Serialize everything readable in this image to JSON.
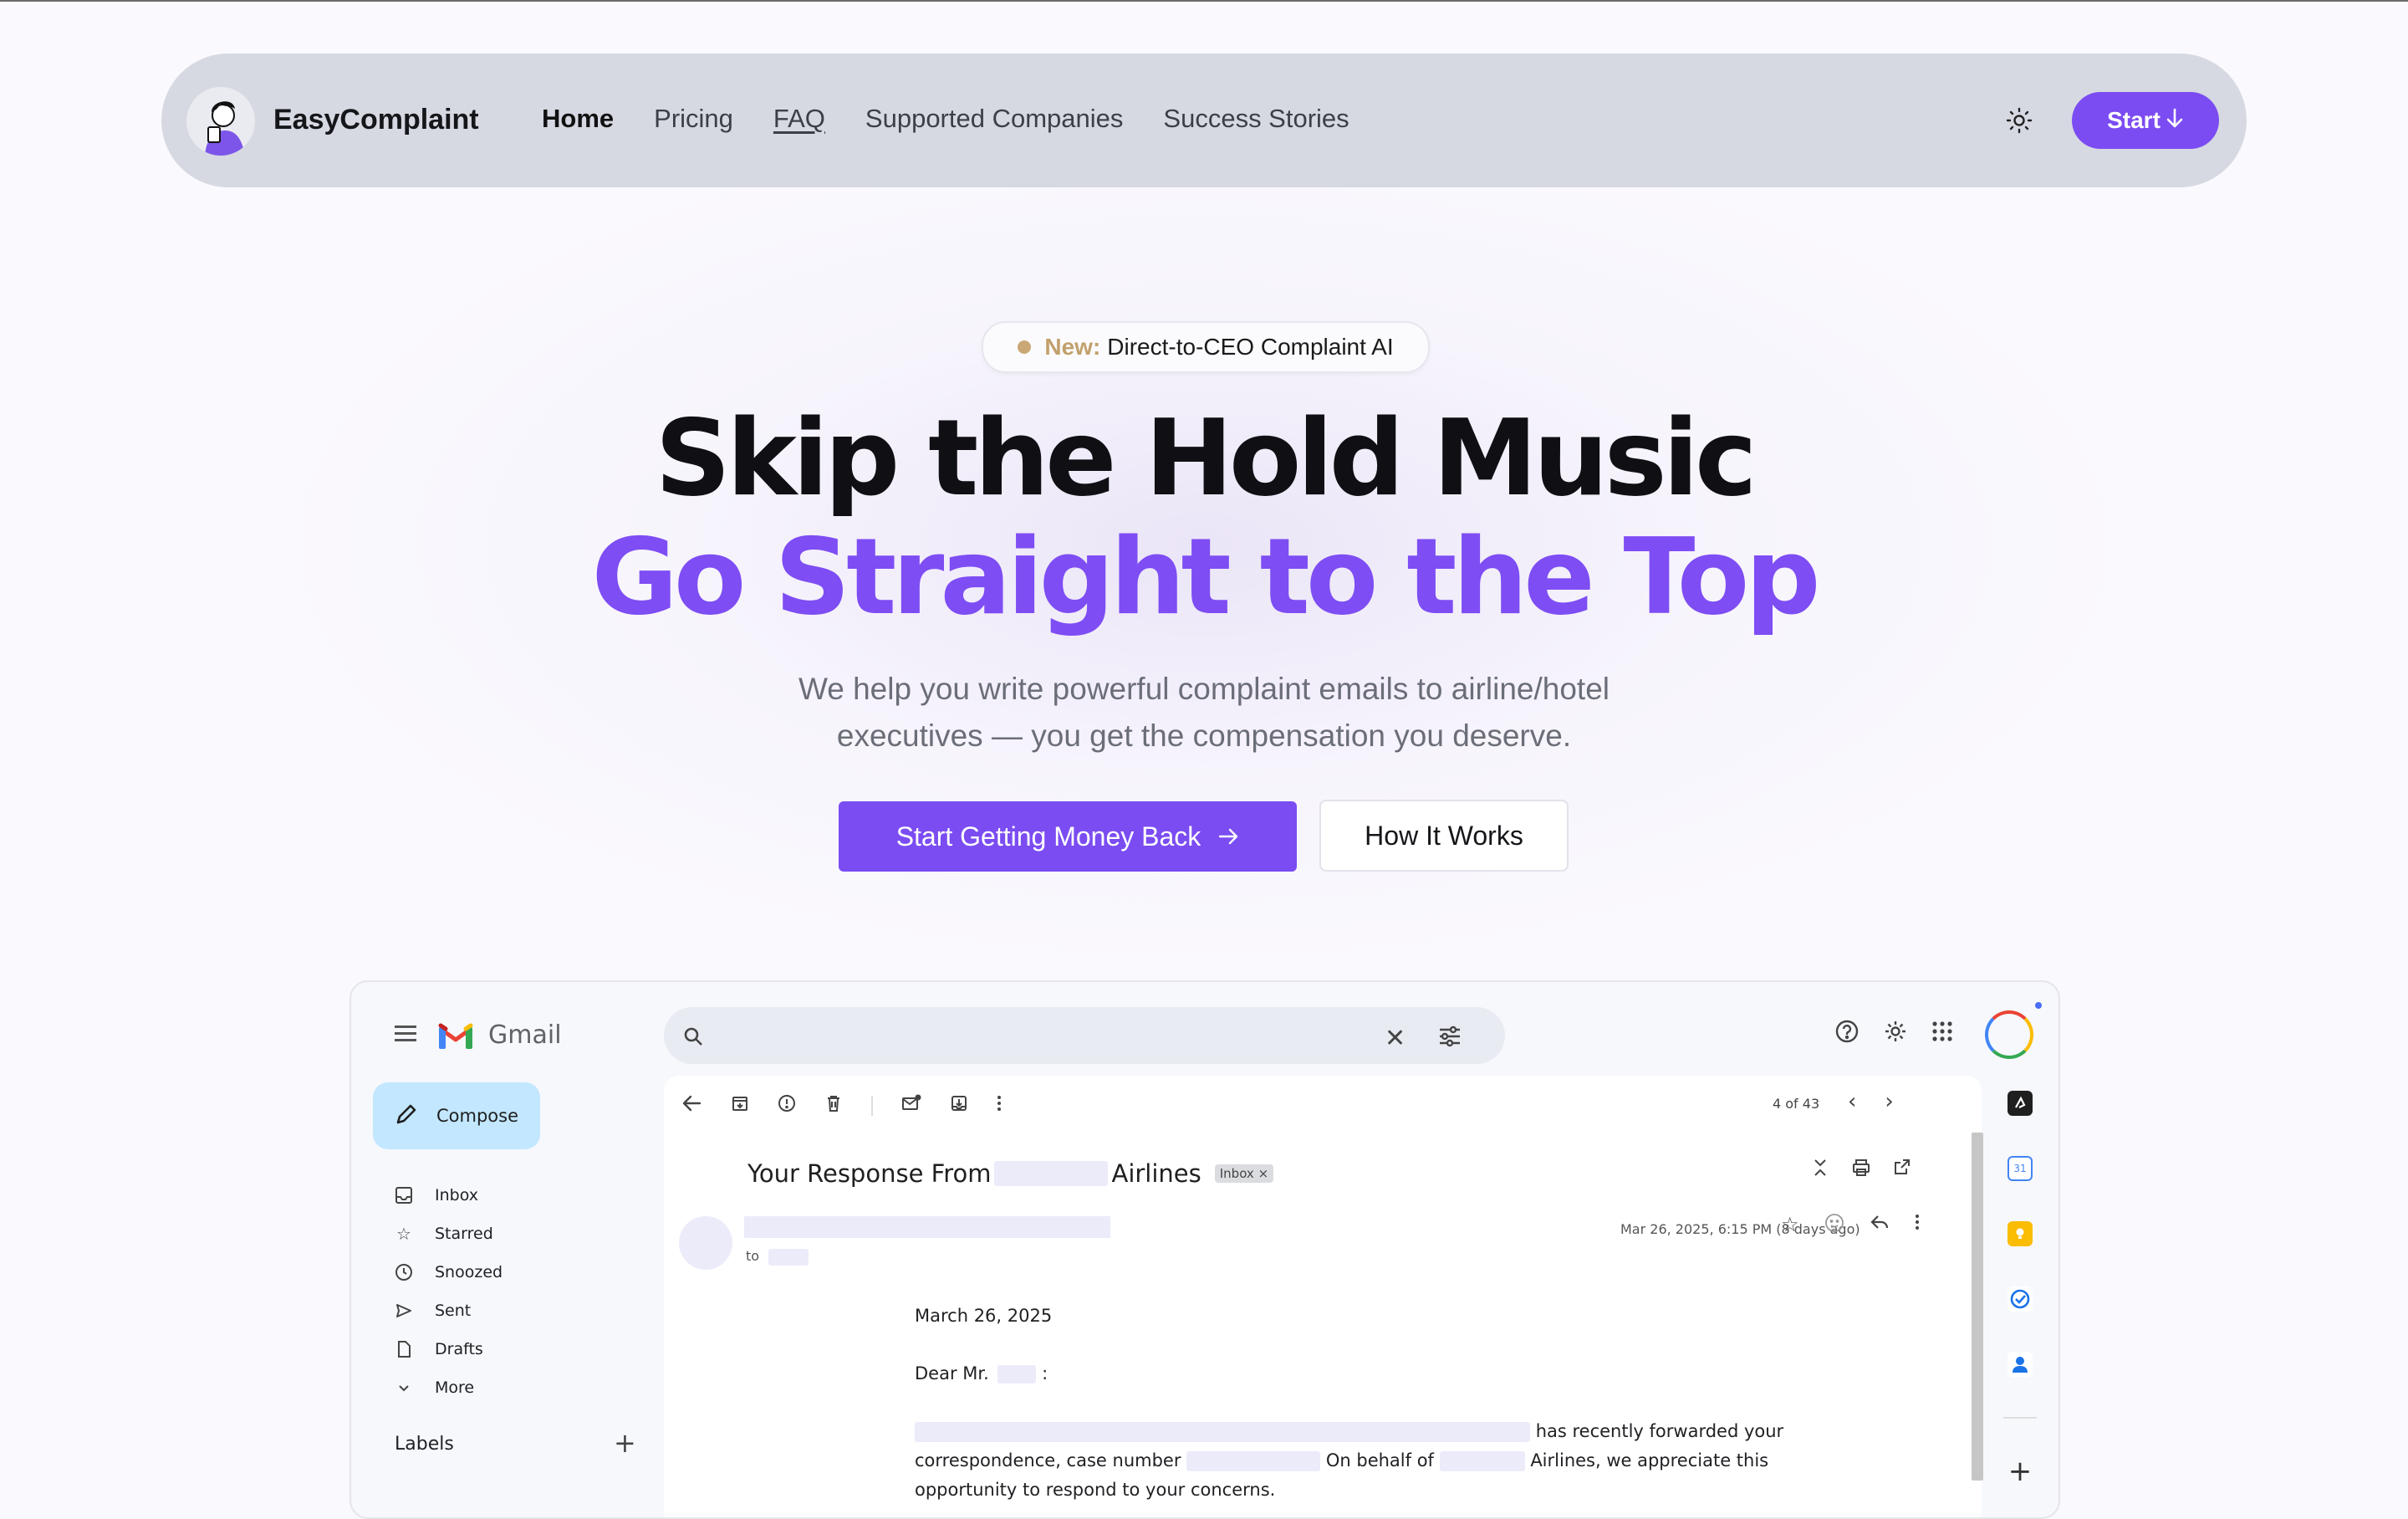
{
  "nav": {
    "brand": "EasyComplaint",
    "links": [
      "Home",
      "Pricing",
      "FAQ",
      "Supported Companies",
      "Success Stories"
    ],
    "start_label": "Start"
  },
  "hero": {
    "badge_new": "New:",
    "badge_text": "Direct-to-CEO Complaint AI",
    "title_line1": "Skip the Hold Music",
    "title_line2": "Go Straight to the Top",
    "subtitle_line1": "We help you write powerful complaint emails to airline/hotel",
    "subtitle_line2": "executives — you get the compensation you deserve.",
    "cta_primary": "Start Getting Money Back",
    "cta_secondary": "How It Works"
  },
  "gmail": {
    "app_name": "Gmail",
    "compose_label": "Compose",
    "nav_items": [
      "Inbox",
      "Starred",
      "Snoozed",
      "Sent",
      "Drafts",
      "More"
    ],
    "labels_heading": "Labels",
    "pager": "4 of 43",
    "subject_prefix": "Your Response From",
    "subject_suffix": "Airlines",
    "inbox_chip": "Inbox ×",
    "to_label": "to",
    "date": "Mar 26, 2025, 6:15 PM (8 days ago)",
    "body_date": "March 26, 2025",
    "salutation": "Dear Mr.",
    "salutation_colon": ":",
    "para_part1": "has recently forwarded your",
    "para_part2": "correspondence, case number",
    "para_part3": "On behalf of",
    "para_part4": "Airlines, we appreciate this",
    "para_part5": "opportunity to respond to your concerns."
  },
  "colors": {
    "accent": "#7b4cf2",
    "nav_bg": "#d6d9e2",
    "badge_gold": "#c2a06c",
    "compose_bg": "#c2e7ff"
  }
}
